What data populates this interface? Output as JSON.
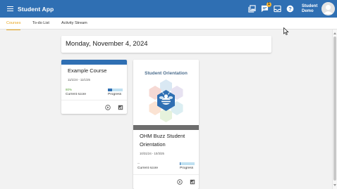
{
  "app": {
    "title": "Student App",
    "user_name_line1": "Student",
    "user_name_line2": "Demo",
    "notification_count": "1",
    "accent": "#2f6fb3",
    "tab_accent": "#e7a51f"
  },
  "tabs": [
    {
      "label": "Courses",
      "active": true
    },
    {
      "label": "To-do List",
      "active": false
    },
    {
      "label": "Activity Stream",
      "active": false
    }
  ],
  "date_header": "Monday, November 4, 2024",
  "courses": [
    {
      "title": "Example Course",
      "dates": "11/1/24 - 11/1/25",
      "score": "80%",
      "score_label": "Current score",
      "progress_label": "Progress",
      "progress": 0.3
    },
    {
      "title_line1": "OHM Buzz Student",
      "title_line2": "Orientation",
      "thumbnail_caption": "Student Orientation",
      "dates": "10/31/24 - 10/3/25",
      "score": "--",
      "score_label": "Current score",
      "progress_label": "Progress",
      "progress": 0.05
    }
  ],
  "icons": {
    "toolbar": [
      "gallery-icon",
      "chat-icon",
      "inbox-icon",
      "help-icon"
    ],
    "card_actions": [
      "play-icon",
      "gradebook-icon"
    ]
  }
}
